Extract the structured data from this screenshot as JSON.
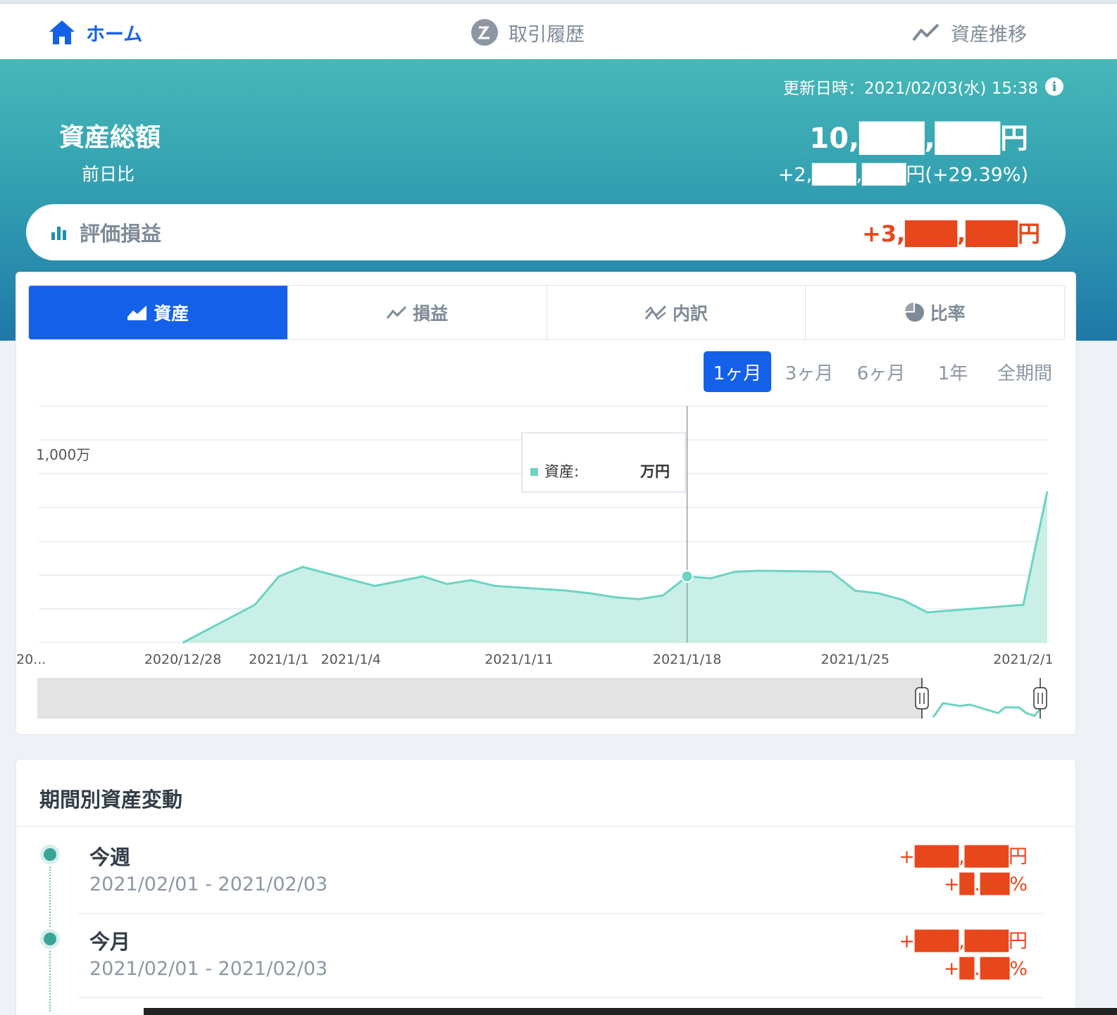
{
  "nav": {
    "home": "ホーム",
    "history": "取引履歴",
    "trend": "資産推移"
  },
  "header": {
    "updated": "更新日時：2021/02/03(水) 15:38",
    "total_label": "資産総額",
    "prev_label": "前日比",
    "total_value": "10,███,███円",
    "prev_value": "+2,███,███円(+29.39%)"
  },
  "pnl": {
    "label": "評価損益",
    "value": "+3,███,███円"
  },
  "tabs": [
    {
      "label": "資産",
      "icon": "area-chart-icon",
      "active": true
    },
    {
      "label": "損益",
      "icon": "line-chart-icon",
      "active": false
    },
    {
      "label": "内訳",
      "icon": "multi-line-chart-icon",
      "active": false
    },
    {
      "label": "比率",
      "icon": "pie-chart-icon",
      "active": false
    }
  ],
  "ranges": [
    "1ヶ月",
    "3ヶ月",
    "6ヶ月",
    "1年",
    "全期間"
  ],
  "chart_data": {
    "type": "area",
    "ylabel_ticks": [
      "1,000万"
    ],
    "x_ticks": [
      "20...",
      "2020/12/28",
      "2021/1/1",
      "2021/1/4",
      "2021/1/11",
      "2021/1/18",
      "2021/1/25",
      "2021/2/1"
    ],
    "x": [
      0,
      3,
      4,
      5,
      8,
      9,
      10,
      11,
      12,
      13,
      16,
      17,
      18,
      19,
      20,
      21,
      22,
      23,
      24,
      27,
      28,
      29,
      30,
      31,
      32,
      35,
      36
    ],
    "values": [
      780,
      820,
      850,
      860,
      840,
      845,
      850,
      842,
      846,
      840,
      835,
      832,
      828,
      826,
      830,
      850,
      848,
      855,
      856,
      855,
      835,
      832,
      825,
      812,
      814,
      820,
      940
    ],
    "ylim": [
      780,
      1030
    ],
    "tooltip": {
      "label": "資産:",
      "unit": "万円"
    },
    "color": "#6dd3c3"
  },
  "period": {
    "title": "期間別資産変動",
    "rows": [
      {
        "name": "今週",
        "range": "2021/02/01 - 2021/02/03",
        "value": "+███,███円",
        "pct": "+█.██%"
      },
      {
        "name": "今月",
        "range": "2021/02/01 - 2021/02/03",
        "value": "+███,███円",
        "pct": "+█.██%"
      }
    ]
  }
}
